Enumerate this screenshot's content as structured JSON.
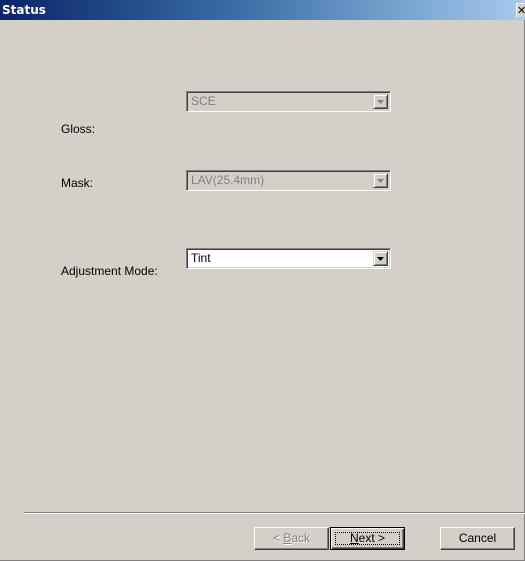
{
  "window": {
    "title": "Status",
    "close_glyph": "✕"
  },
  "form": {
    "gloss": {
      "label": "Gloss:",
      "value": "SCE",
      "enabled": false
    },
    "mask": {
      "label": "Mask:",
      "value": "LAV(25.4mm)",
      "enabled": false
    },
    "adjustment_mode": {
      "label": "Adjustment Mode:",
      "value": "Tint",
      "enabled": true
    }
  },
  "buttons": {
    "back": {
      "prefix": "< ",
      "mnemonic": "B",
      "rest": "ack",
      "enabled": false
    },
    "next": {
      "mnemonic": "N",
      "rest": "ext >",
      "enabled": true,
      "default": true
    },
    "cancel": {
      "label": "Cancel",
      "enabled": true
    }
  },
  "icons": {
    "close": "close-icon",
    "dropdown": "chevron-down-icon"
  },
  "colors": {
    "title_gradient_start": "#0a246a",
    "title_gradient_end": "#a6caf0",
    "dialog_face": "#d4d0c8",
    "disabled_text": "#808080"
  }
}
